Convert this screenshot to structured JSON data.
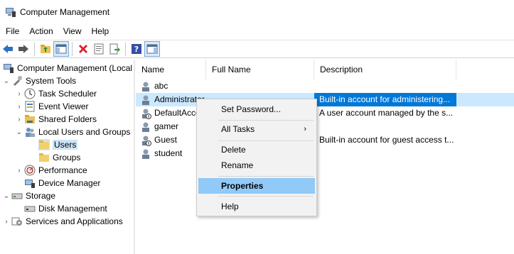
{
  "window": {
    "title": "Computer Management"
  },
  "menu": [
    "File",
    "Action",
    "View",
    "Help"
  ],
  "toolbar": {
    "buttons": [
      "back-icon",
      "forward-icon",
      "up-folder-icon",
      "show-hide-tree-icon",
      "delete-icon",
      "properties-icon",
      "export-list-icon",
      "help-icon",
      "show-action-pane-icon"
    ]
  },
  "tree": {
    "root": "Computer Management (Local",
    "system_tools": "System Tools",
    "task_scheduler": "Task Scheduler",
    "event_viewer": "Event Viewer",
    "shared_folders": "Shared Folders",
    "local_users_groups": "Local Users and Groups",
    "users": "Users",
    "groups": "Groups",
    "performance": "Performance",
    "device_manager": "Device Manager",
    "storage": "Storage",
    "disk_management": "Disk Management",
    "services_apps": "Services and Applications"
  },
  "list": {
    "columns": {
      "name": "Name",
      "full_name": "Full Name",
      "description": "Description"
    },
    "rows": [
      {
        "name": "abc",
        "full_name": "",
        "description": ""
      },
      {
        "name": "Administrator",
        "full_name": "",
        "description": "Built-in account for administering..."
      },
      {
        "name": "DefaultAcco",
        "full_name": "",
        "description": "A user account managed by the s..."
      },
      {
        "name": "gamer",
        "full_name": "",
        "description": ""
      },
      {
        "name": "Guest",
        "full_name": "",
        "description": "Built-in account for guest access t..."
      },
      {
        "name": "student",
        "full_name": "",
        "description": ""
      }
    ]
  },
  "context_menu": {
    "set_password": "Set Password...",
    "all_tasks": "All Tasks",
    "all_tasks_arrow": "›",
    "delete": "Delete",
    "rename": "Rename",
    "properties": "Properties",
    "help": "Help"
  },
  "colors": {
    "selection_row": "#cce8ff",
    "selection_desc": "#0078d7",
    "menu_highlight": "#91c9f7"
  }
}
